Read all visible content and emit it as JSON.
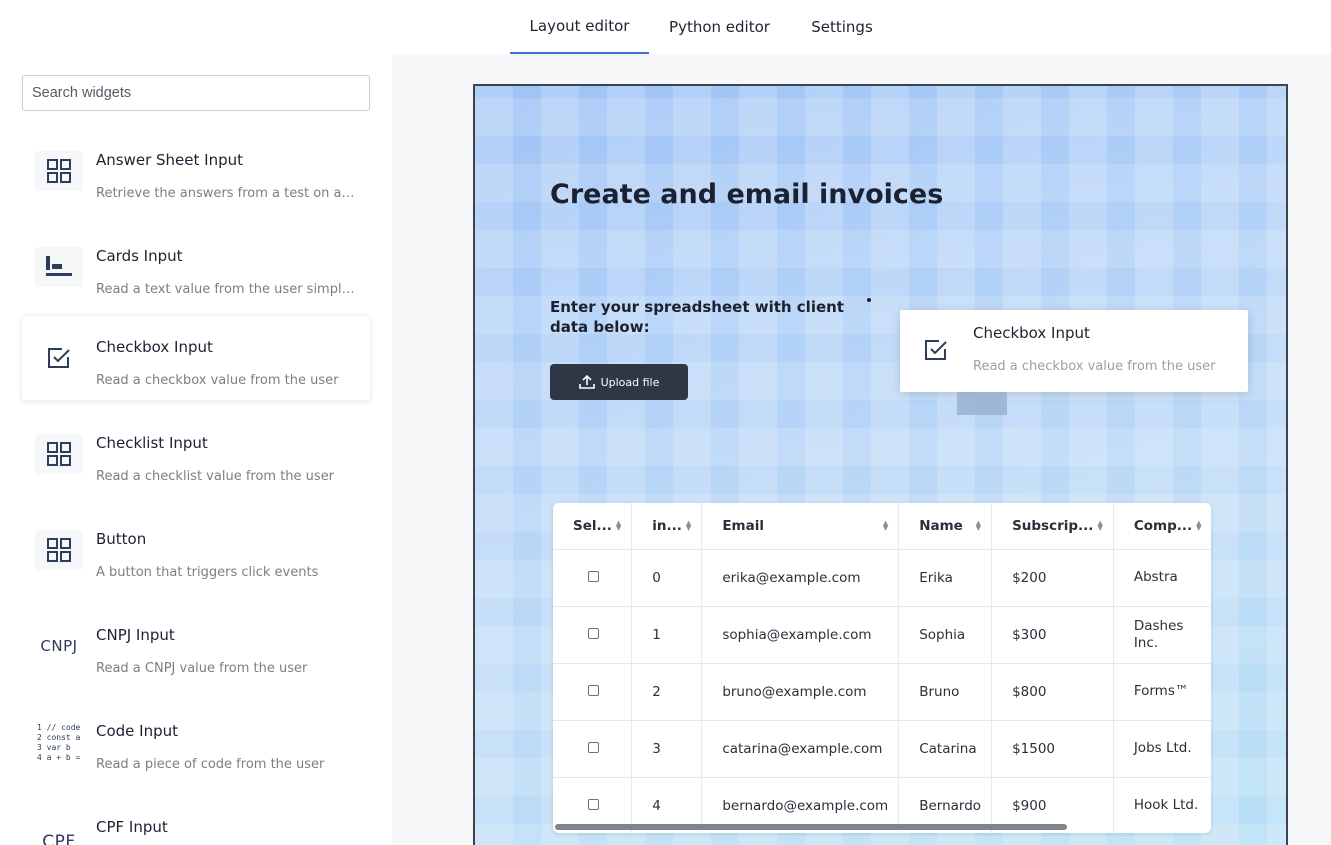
{
  "tabs": [
    {
      "label": "Layout editor",
      "active": true
    },
    {
      "label": "Python editor",
      "active": false
    },
    {
      "label": "Settings",
      "active": false
    }
  ],
  "sidebar": {
    "search_placeholder": "Search widgets",
    "widgets": [
      {
        "title": "Answer Sheet Input",
        "desc": "Retrieve the answers from a test on a us...",
        "icon": "grid-icon"
      },
      {
        "title": "Cards Input",
        "desc": "Read a text value from the user simple te...",
        "icon": "cards-icon"
      },
      {
        "title": "Checkbox Input",
        "desc": "Read a checkbox value from the user",
        "icon": "checkbox-icon"
      },
      {
        "title": "Checklist Input",
        "desc": "Read a checklist value from the user",
        "icon": "grid-icon"
      },
      {
        "title": "Button",
        "desc": "A button that triggers click events",
        "icon": "grid-icon"
      },
      {
        "title": "CNPJ Input",
        "desc": "Read a CNPJ value from the user",
        "icon": "cnpj-icon",
        "icon_text": "CNPJ"
      },
      {
        "title": "Code Input",
        "desc": "Read a piece of code from the user",
        "icon": "code-icon",
        "icon_lines": [
          "1 // code",
          "2 const a",
          "3 var b",
          "4 a + b ="
        ]
      },
      {
        "title": "CPF Input",
        "desc": "",
        "icon": "cpf-icon",
        "icon_text": "CPF"
      }
    ]
  },
  "canvas": {
    "title": "Create and email invoices",
    "subtitle": "Enter your spreadsheet with client data below:",
    "upload_label": "Upload file",
    "drag_card": {
      "title": "Checkbox Input",
      "desc": "Read a checkbox value from the user"
    },
    "table": {
      "headers": [
        "Sel...",
        "in...",
        "Email",
        "Name",
        "Subscrip...",
        "Comp..."
      ],
      "rows": [
        [
          "",
          "0",
          "erika@example.com",
          "Erika",
          "$200",
          "Abstra"
        ],
        [
          "",
          "1",
          "sophia@example.com",
          "Sophia",
          "$300",
          "Dashes Inc."
        ],
        [
          "",
          "2",
          "bruno@example.com",
          "Bruno",
          "$800",
          "Forms™"
        ],
        [
          "",
          "3",
          "catarina@example.com",
          "Catarina",
          "$1500",
          "Jobs Ltd."
        ],
        [
          "",
          "4",
          "bernardo@example.com",
          "Bernardo",
          "$900",
          "Hook Ltd."
        ]
      ]
    }
  },
  "colors": {
    "accent": "#3b6fd6",
    "dark_button": "#2f3744",
    "icon": "#2d3e5c"
  }
}
